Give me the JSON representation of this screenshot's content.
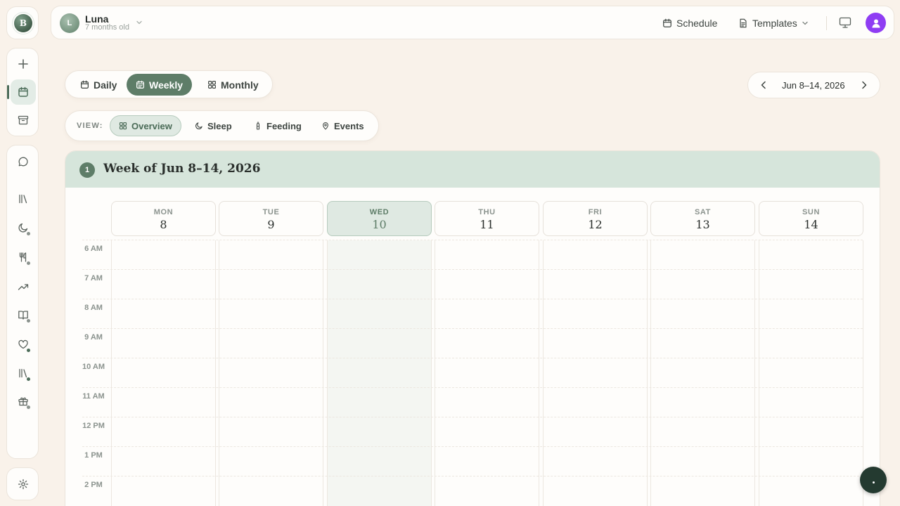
{
  "sidebar": {
    "avatar_letter": "B",
    "icons": [
      "plus-icon",
      "calendar-icon",
      "archive-icon",
      "chat-icon",
      "library-icon",
      "moon-icon",
      "utensils-icon",
      "trend-icon",
      "book-icon",
      "heart-icon",
      "library-icon",
      "gift-icon",
      "gear-icon"
    ]
  },
  "topbar": {
    "child_initial": "L",
    "child_name": "Luna",
    "child_age": "7 months old",
    "schedule_label": "Schedule",
    "templates_label": "Templates"
  },
  "range_tabs": [
    {
      "label": "Daily",
      "active": false
    },
    {
      "label": "Weekly",
      "active": true
    },
    {
      "label": "Monthly",
      "active": false
    }
  ],
  "date_nav": {
    "label": "Jun 8–14, 2026"
  },
  "view": {
    "label": "VIEW:",
    "options": [
      {
        "label": "Overview",
        "active": true
      },
      {
        "label": "Sleep",
        "active": false
      },
      {
        "label": "Feeding",
        "active": false
      },
      {
        "label": "Events",
        "active": false
      }
    ]
  },
  "calendar": {
    "week_number": "1",
    "title": "Week of Jun 8–14, 2026",
    "days": [
      {
        "name": "MON",
        "num": "8",
        "today": false
      },
      {
        "name": "TUE",
        "num": "9",
        "today": false
      },
      {
        "name": "WED",
        "num": "10",
        "today": true
      },
      {
        "name": "THU",
        "num": "11",
        "today": false
      },
      {
        "name": "FRI",
        "num": "12",
        "today": false
      },
      {
        "name": "SAT",
        "num": "13",
        "today": false
      },
      {
        "name": "SUN",
        "num": "14",
        "today": false
      }
    ],
    "hours": [
      "6 AM",
      "7 AM",
      "8 AM",
      "9 AM",
      "10 AM",
      "11 AM",
      "12 PM",
      "1 PM",
      "2 PM"
    ]
  },
  "colors": {
    "accent": "#5e7d68",
    "header_band": "#d6e5db",
    "background": "#f9f2ea",
    "user_avatar": "#8f3df3"
  }
}
